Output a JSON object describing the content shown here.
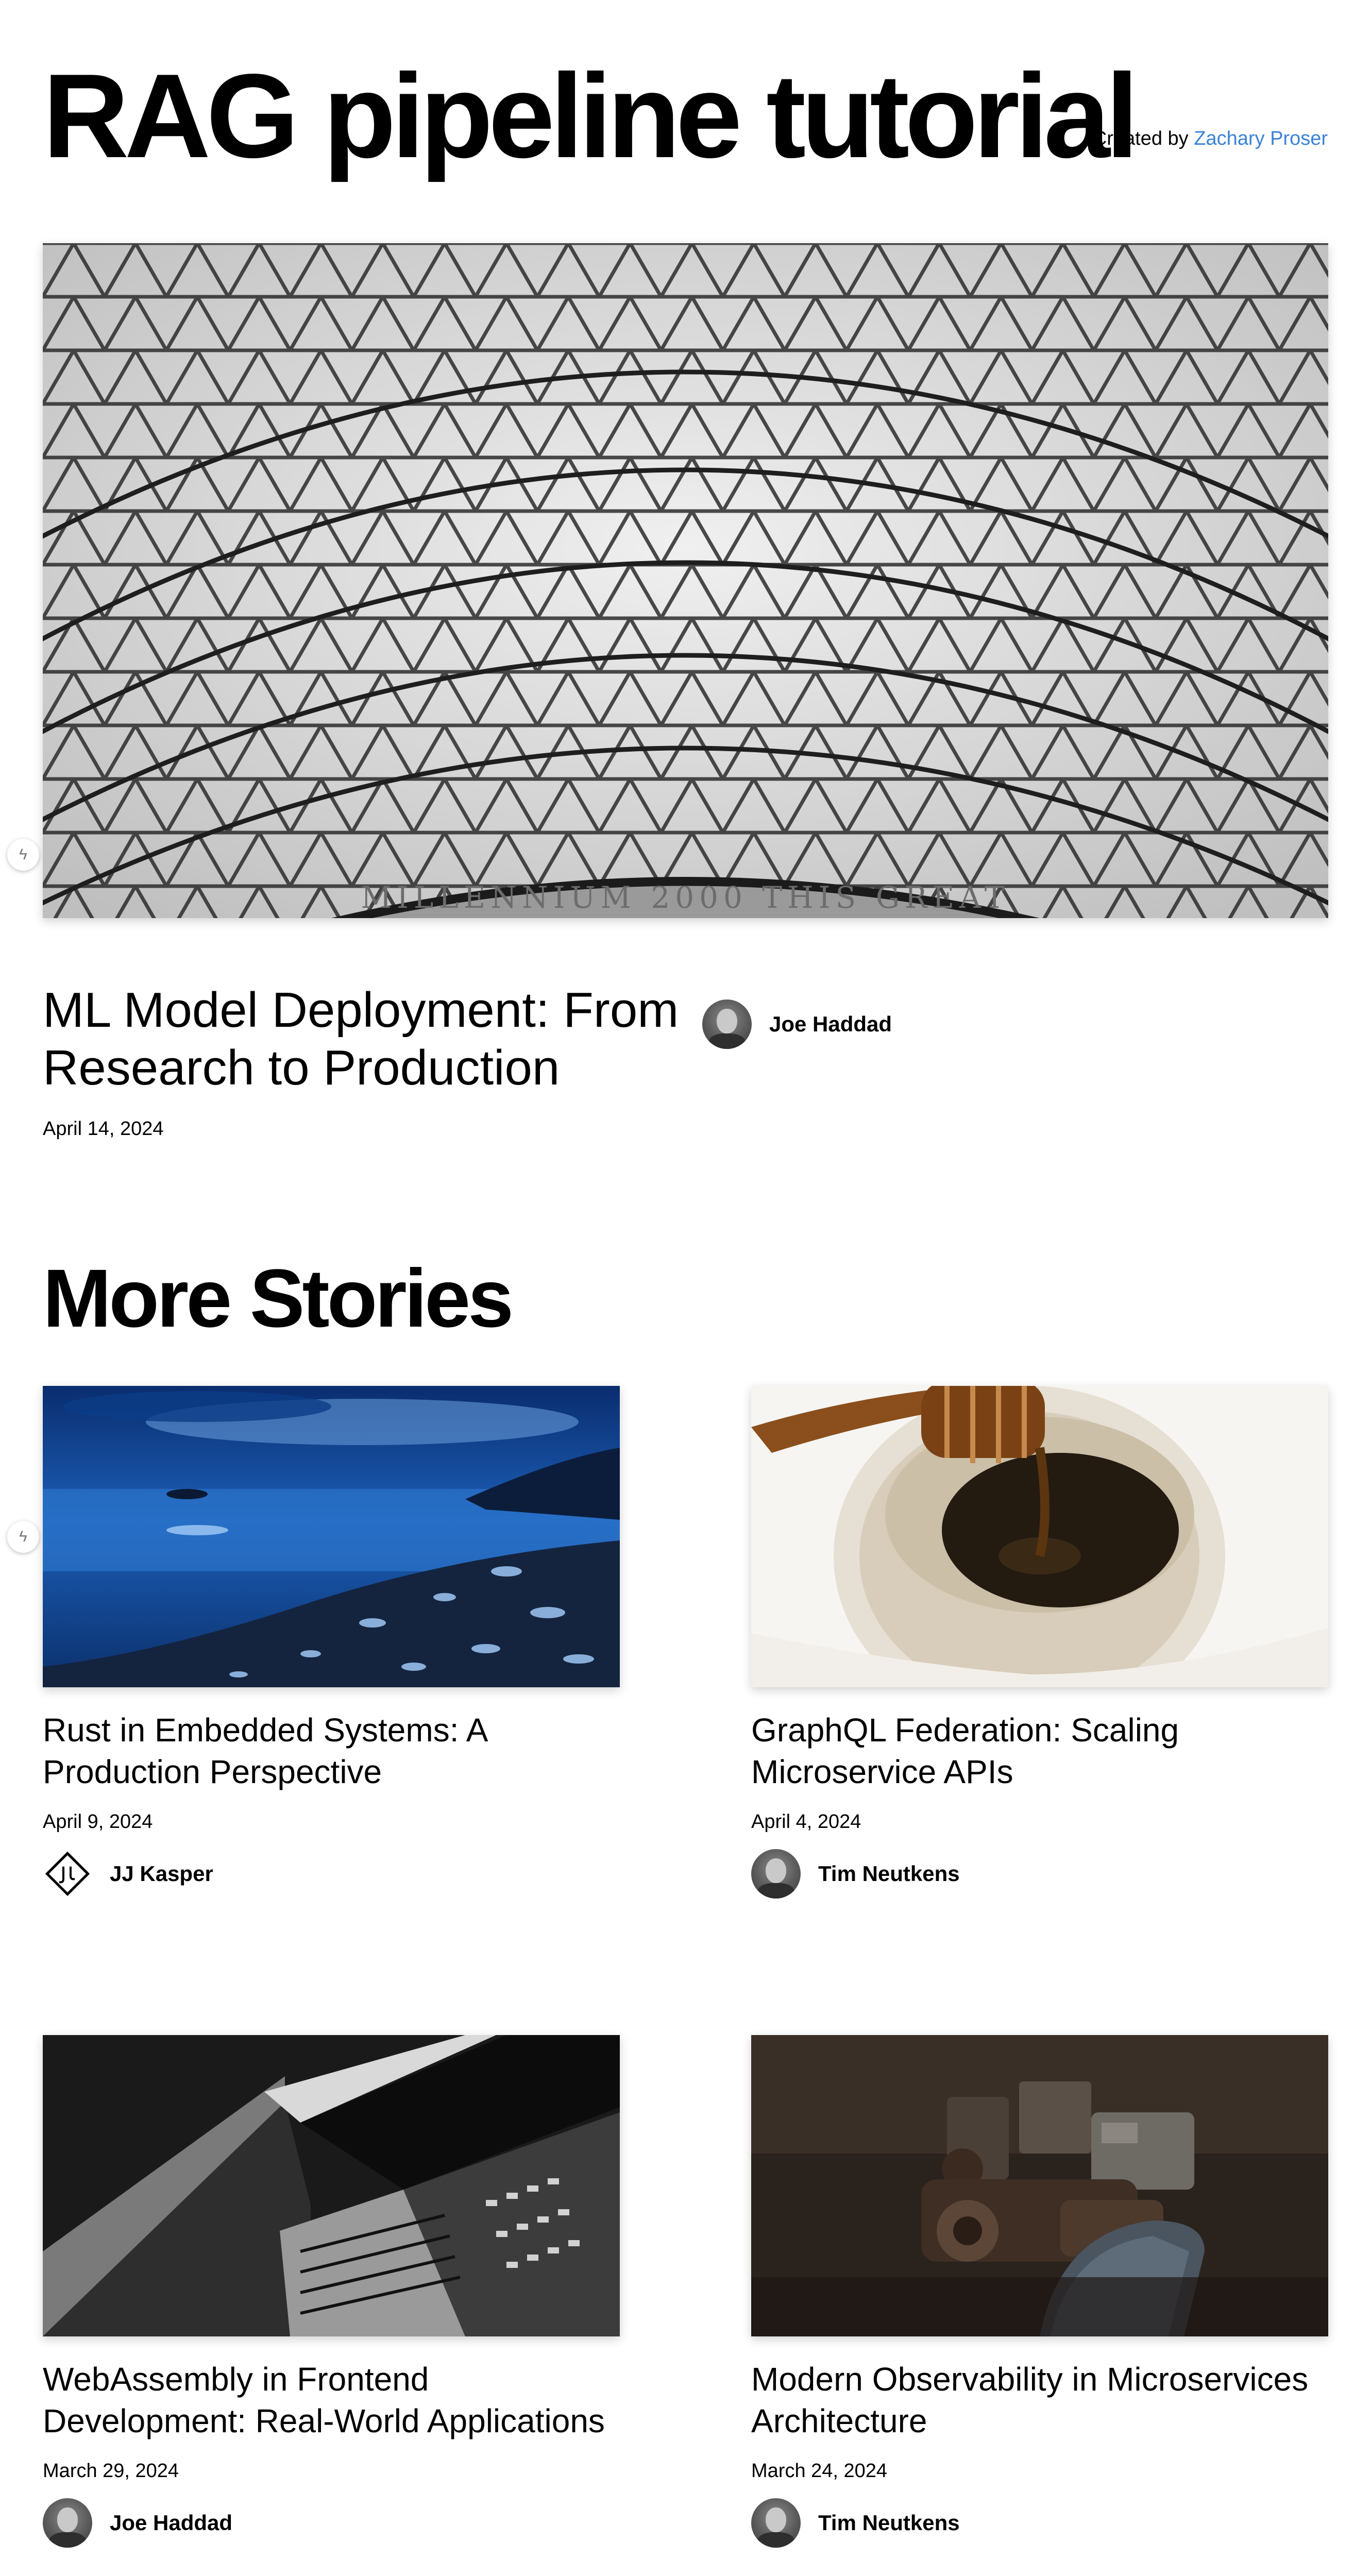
{
  "header": {
    "title": "RAG pipeline tutorial",
    "created_by_prefix": "Created by",
    "created_by_name": "Zachary Proser"
  },
  "hero": {
    "title": "ML Model Deployment: From Research to Production",
    "date": "April 14, 2024",
    "author": "Joe Haddad",
    "image_inscription": "MILLENNIUM 2000 THIS GREAT"
  },
  "more_stories": {
    "title": "More Stories",
    "stories": [
      {
        "title": "Rust in Embedded Systems: A Production Perspective",
        "date": "April 9, 2024",
        "author": "JJ Kasper"
      },
      {
        "title": "GraphQL Federation: Scaling Microservice APIs",
        "date": "April 4, 2024",
        "author": "Tim Neutkens"
      },
      {
        "title": "WebAssembly in Frontend Development: Real-World Applications",
        "date": "March 29, 2024",
        "author": "Joe Haddad"
      },
      {
        "title": "Modern Observability in Microservices Architecture",
        "date": "March 24, 2024",
        "author": "Tim Neutkens"
      }
    ]
  },
  "colors": {
    "link": "#3b82d6",
    "text": "#000000",
    "background": "#ffffff"
  },
  "icons": {
    "side_buttons": "lightning-icon",
    "author_logo": "jj-logo-icon"
  }
}
